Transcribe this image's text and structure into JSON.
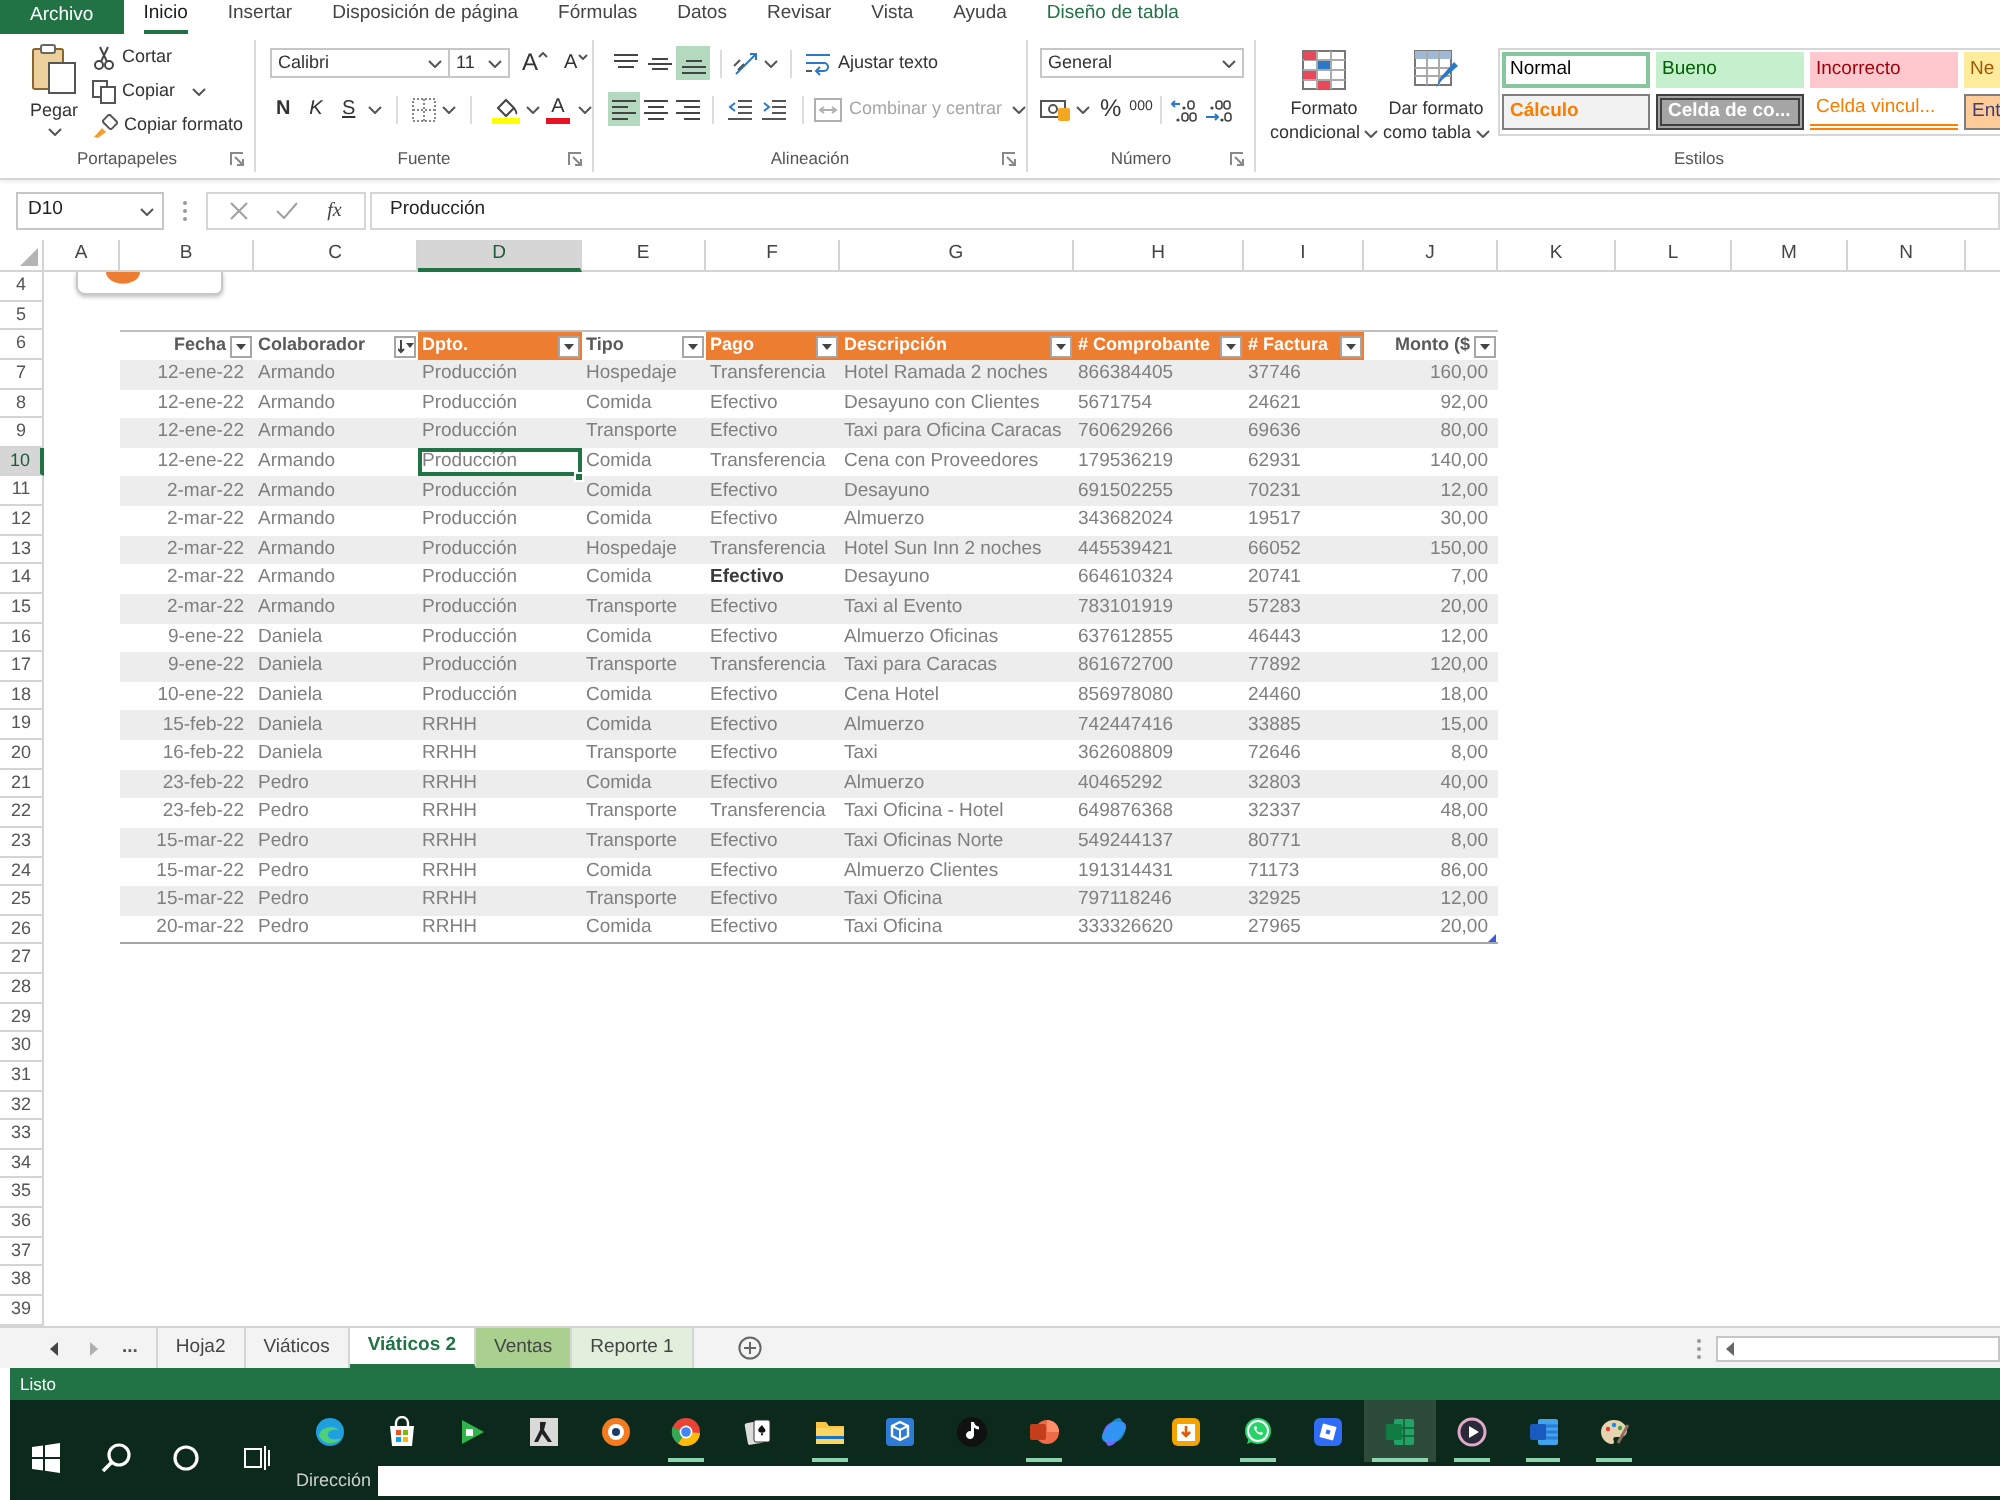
{
  "ribbon_tabs": [
    {
      "label": "Archivo",
      "kind": "file",
      "selected": false
    },
    {
      "label": "Inicio",
      "kind": "tab",
      "selected": true
    },
    {
      "label": "Insertar",
      "kind": "tab",
      "selected": false
    },
    {
      "label": "Disposición de página",
      "kind": "tab",
      "selected": false
    },
    {
      "label": "Fórmulas",
      "kind": "tab",
      "selected": false
    },
    {
      "label": "Datos",
      "kind": "tab",
      "selected": false
    },
    {
      "label": "Revisar",
      "kind": "tab",
      "selected": false
    },
    {
      "label": "Vista",
      "kind": "tab",
      "selected": false
    },
    {
      "label": "Ayuda",
      "kind": "tab",
      "selected": false
    },
    {
      "label": "Diseño de tabla",
      "kind": "contextual",
      "selected": false
    }
  ],
  "ribbon": {
    "clipboard": {
      "title": "Portapapeles",
      "paste": "Pegar",
      "cut": "Cortar",
      "copy": "Copiar",
      "format_painter": "Copiar formato"
    },
    "font": {
      "title": "Fuente",
      "font_name": "Calibri",
      "font_size": "11",
      "grow": "A",
      "shrink": "A",
      "bold": "N",
      "italic": "K",
      "underline": "S",
      "font_color": "A"
    },
    "alignment": {
      "title": "Alineación",
      "vertical": [
        {
          "kind": "top",
          "selected": false
        },
        {
          "kind": "middle",
          "selected": false
        },
        {
          "kind": "bottom",
          "selected": true
        }
      ],
      "wrap_text": "Ajustar texto",
      "horizontal": [
        {
          "kind": "left",
          "selected": true
        },
        {
          "kind": "center",
          "selected": false
        },
        {
          "kind": "right",
          "selected": false
        }
      ],
      "merge": {
        "label": "Combinar y centrar",
        "disabled": true
      }
    },
    "number": {
      "title": "Número",
      "format": "General",
      "percent": "%",
      "thousands": "000"
    },
    "styles": {
      "title": "Estilos",
      "conditional_format": "Formato condicional",
      "format_as_table": "Dar formato como tabla",
      "gallery": [
        {
          "label": "Normal",
          "kind": "normal",
          "selected": true
        },
        {
          "label": "Bueno",
          "kind": "good",
          "selected": false
        },
        {
          "label": "Incorrecto",
          "kind": "bad",
          "selected": false
        },
        {
          "label": "Ne",
          "kind": "neutral",
          "selected": false
        },
        {
          "label": "Cálculo",
          "kind": "calculation",
          "selected": false
        },
        {
          "label": "Celda de co...",
          "kind": "check",
          "selected": false
        },
        {
          "label": "Celda vincul...",
          "kind": "linked",
          "selected": false
        },
        {
          "label": "Ent",
          "kind": "input",
          "selected": false
        }
      ]
    }
  },
  "formula_bar": {
    "name_box": "D10",
    "function_label": "fx",
    "value": "Producción"
  },
  "sheet": {
    "column_headers": [
      {
        "label": "A",
        "selected": false
      },
      {
        "label": "B",
        "selected": false
      },
      {
        "label": "C",
        "selected": false
      },
      {
        "label": "D",
        "selected": true
      },
      {
        "label": "E",
        "selected": false
      },
      {
        "label": "F",
        "selected": false
      },
      {
        "label": "G",
        "selected": false
      },
      {
        "label": "H",
        "selected": false
      },
      {
        "label": "I",
        "selected": false
      },
      {
        "label": "J",
        "selected": false
      },
      {
        "label": "K",
        "selected": false
      },
      {
        "label": "L",
        "selected": false
      },
      {
        "label": "M",
        "selected": false
      },
      {
        "label": "N",
        "selected": false
      }
    ],
    "row_numbers": [
      {
        "label": "4",
        "selected": false
      },
      {
        "label": "5",
        "selected": false
      },
      {
        "label": "6",
        "selected": false
      },
      {
        "label": "7",
        "selected": false
      },
      {
        "label": "8",
        "selected": false
      },
      {
        "label": "9",
        "selected": false
      },
      {
        "label": "10",
        "selected": true
      },
      {
        "label": "11",
        "selected": false
      },
      {
        "label": "12",
        "selected": false
      },
      {
        "label": "13",
        "selected": false
      },
      {
        "label": "14",
        "selected": false
      },
      {
        "label": "15",
        "selected": false
      },
      {
        "label": "16",
        "selected": false
      },
      {
        "label": "17",
        "selected": false
      },
      {
        "label": "18",
        "selected": false
      },
      {
        "label": "19",
        "selected": false
      },
      {
        "label": "20",
        "selected": false
      },
      {
        "label": "21",
        "selected": false
      },
      {
        "label": "22",
        "selected": false
      },
      {
        "label": "23",
        "selected": false
      },
      {
        "label": "24",
        "selected": false
      },
      {
        "label": "25",
        "selected": false
      },
      {
        "label": "26",
        "selected": false
      },
      {
        "label": "27",
        "selected": false
      },
      {
        "label": "28",
        "selected": false
      },
      {
        "label": "29",
        "selected": false
      },
      {
        "label": "30",
        "selected": false
      },
      {
        "label": "31",
        "selected": false
      },
      {
        "label": "32",
        "selected": false
      },
      {
        "label": "33",
        "selected": false
      },
      {
        "label": "34",
        "selected": false
      },
      {
        "label": "35",
        "selected": false
      },
      {
        "label": "36",
        "selected": false
      },
      {
        "label": "37",
        "selected": false
      },
      {
        "label": "38",
        "selected": false
      },
      {
        "label": "39",
        "selected": false
      }
    ]
  },
  "table": {
    "columns": [
      {
        "label": "Fecha",
        "highlighted": false,
        "sorted": false
      },
      {
        "label": "Colaborador",
        "highlighted": false,
        "sorted": true
      },
      {
        "label": "Dpto.",
        "highlighted": true,
        "sorted": false
      },
      {
        "label": "Tipo",
        "highlighted": false,
        "sorted": false
      },
      {
        "label": "Pago",
        "highlighted": true,
        "sorted": false
      },
      {
        "label": "Descripción",
        "highlighted": true,
        "sorted": false
      },
      {
        "label": "# Comprobante",
        "highlighted": true,
        "sorted": false
      },
      {
        "label": "# Factura",
        "highlighted": true,
        "sorted": false
      },
      {
        "label": "Monto ($",
        "highlighted": false,
        "sorted": false
      }
    ],
    "rows": [
      {
        "cells": [
          "12-ene-22",
          "Armando",
          "Producción",
          "Hospedaje",
          "Transferencia",
          "Hotel Ramada 2 noches",
          "866384405",
          "37746",
          "160,00"
        ]
      },
      {
        "cells": [
          "12-ene-22",
          "Armando",
          "Producción",
          "Comida",
          "Efectivo",
          "Desayuno con Clientes",
          "5671754",
          "24621",
          "92,00"
        ]
      },
      {
        "cells": [
          "12-ene-22",
          "Armando",
          "Producción",
          "Transporte",
          "Efectivo",
          "Taxi para Oficina Caracas",
          "760629266",
          "69636",
          "80,00"
        ]
      },
      {
        "cells": [
          "12-ene-22",
          "Armando",
          {
            "text": "Producción",
            "active": true
          },
          "Comida",
          "Transferencia",
          "Cena con Proveedores",
          "179536219",
          "62931",
          "140,00"
        ]
      },
      {
        "cells": [
          "2-mar-22",
          "Armando",
          "Producción",
          "Comida",
          "Efectivo",
          "Desayuno",
          "691502255",
          "70231",
          "12,00"
        ]
      },
      {
        "cells": [
          "2-mar-22",
          "Armando",
          "Producción",
          "Comida",
          "Efectivo",
          "Almuerzo",
          "343682024",
          "19517",
          "30,00"
        ]
      },
      {
        "cells": [
          "2-mar-22",
          "Armando",
          "Producción",
          "Hospedaje",
          "Transferencia",
          "Hotel Sun Inn 2 noches",
          "445539421",
          "66052",
          "150,00"
        ]
      },
      {
        "cells": [
          "2-mar-22",
          "Armando",
          "Producción",
          "Comida",
          {
            "text": "Efectivo",
            "bold": true
          },
          "Desayuno",
          "664610324",
          "20741",
          "7,00"
        ]
      },
      {
        "cells": [
          "2-mar-22",
          "Armando",
          "Producción",
          "Transporte",
          "Efectivo",
          "Taxi al Evento",
          "783101919",
          "57283",
          "20,00"
        ]
      },
      {
        "cells": [
          "9-ene-22",
          "Daniela",
          "Producción",
          "Comida",
          "Efectivo",
          "Almuerzo Oficinas",
          "637612855",
          "46443",
          "12,00"
        ]
      },
      {
        "cells": [
          "9-ene-22",
          "Daniela",
          "Producción",
          "Transporte",
          "Transferencia",
          "Taxi para Caracas",
          "861672700",
          "77892",
          "120,00"
        ]
      },
      {
        "cells": [
          "10-ene-22",
          "Daniela",
          "Producción",
          "Comida",
          "Efectivo",
          "Cena Hotel",
          "856978080",
          "24460",
          "18,00"
        ]
      },
      {
        "cells": [
          "15-feb-22",
          "Daniela",
          "RRHH",
          "Comida",
          "Efectivo",
          "Almuerzo",
          "742447416",
          "33885",
          "15,00"
        ]
      },
      {
        "cells": [
          "16-feb-22",
          "Daniela",
          "RRHH",
          "Transporte",
          "Efectivo",
          "Taxi",
          "362608809",
          "72646",
          "8,00"
        ]
      },
      {
        "cells": [
          "23-feb-22",
          "Pedro",
          "RRHH",
          "Comida",
          "Efectivo",
          "Almuerzo",
          "40465292",
          "32803",
          "40,00"
        ]
      },
      {
        "cells": [
          "23-feb-22",
          "Pedro",
          "RRHH",
          "Transporte",
          "Transferencia",
          "Taxi Oficina - Hotel",
          "649876368",
          "32337",
          "48,00"
        ]
      },
      {
        "cells": [
          "15-mar-22",
          "Pedro",
          "RRHH",
          "Transporte",
          "Efectivo",
          "Taxi Oficinas Norte",
          "549244137",
          "80771",
          "8,00"
        ]
      },
      {
        "cells": [
          "15-mar-22",
          "Pedro",
          "RRHH",
          "Comida",
          "Efectivo",
          "Almuerzo Clientes",
          "191314431",
          "71173",
          "86,00"
        ]
      },
      {
        "cells": [
          "15-mar-22",
          "Pedro",
          "RRHH",
          "Transporte",
          "Efectivo",
          "Taxi Oficina",
          "797118246",
          "32925",
          "12,00"
        ]
      },
      {
        "cells": [
          "20-mar-22",
          "Pedro",
          "RRHH",
          "Comida",
          "Efectivo",
          "Taxi Oficina",
          "333326620",
          "27965",
          "20,00"
        ]
      }
    ]
  },
  "sheet_tabs": {
    "more": "...",
    "tabs": [
      {
        "label": "Hoja2",
        "selected": false
      },
      {
        "label": "Viáticos",
        "selected": false
      },
      {
        "label": "Viáticos 2",
        "selected": true
      },
      {
        "label": "Ventas",
        "selected": false,
        "color": "#a9d08e"
      },
      {
        "label": "Reporte 1",
        "selected": false,
        "color": "#e2efda"
      }
    ]
  },
  "status_bar": {
    "text": "Listo"
  },
  "taskbar": {
    "apps": [
      {
        "kind": "globe",
        "running": false,
        "active": false
      },
      {
        "kind": "bag",
        "running": false,
        "active": false
      },
      {
        "kind": "arrow",
        "running": false,
        "active": false
      },
      {
        "kind": "figure",
        "running": false,
        "active": false
      },
      {
        "kind": "ring",
        "running": false,
        "active": false
      },
      {
        "kind": "wheel",
        "running": true,
        "active": false
      },
      {
        "kind": "cards",
        "running": false,
        "active": false
      },
      {
        "kind": "folder",
        "running": true,
        "active": false
      },
      {
        "kind": "cube",
        "running": false,
        "active": false
      },
      {
        "kind": "note",
        "running": false,
        "active": false
      },
      {
        "kind": "slides",
        "running": true,
        "active": false
      },
      {
        "kind": "blob",
        "running": false,
        "active": false
      },
      {
        "kind": "download",
        "running": false,
        "active": false
      },
      {
        "kind": "chat",
        "running": true,
        "active": false
      },
      {
        "kind": "tile",
        "running": false,
        "active": false
      },
      {
        "kind": "sheet",
        "running": true,
        "active": true
      },
      {
        "kind": "play",
        "running": true,
        "active": false
      },
      {
        "kind": "document",
        "running": true,
        "active": false
      },
      {
        "kind": "palette",
        "running": true,
        "active": false
      }
    ],
    "address_label": "Dirección"
  }
}
